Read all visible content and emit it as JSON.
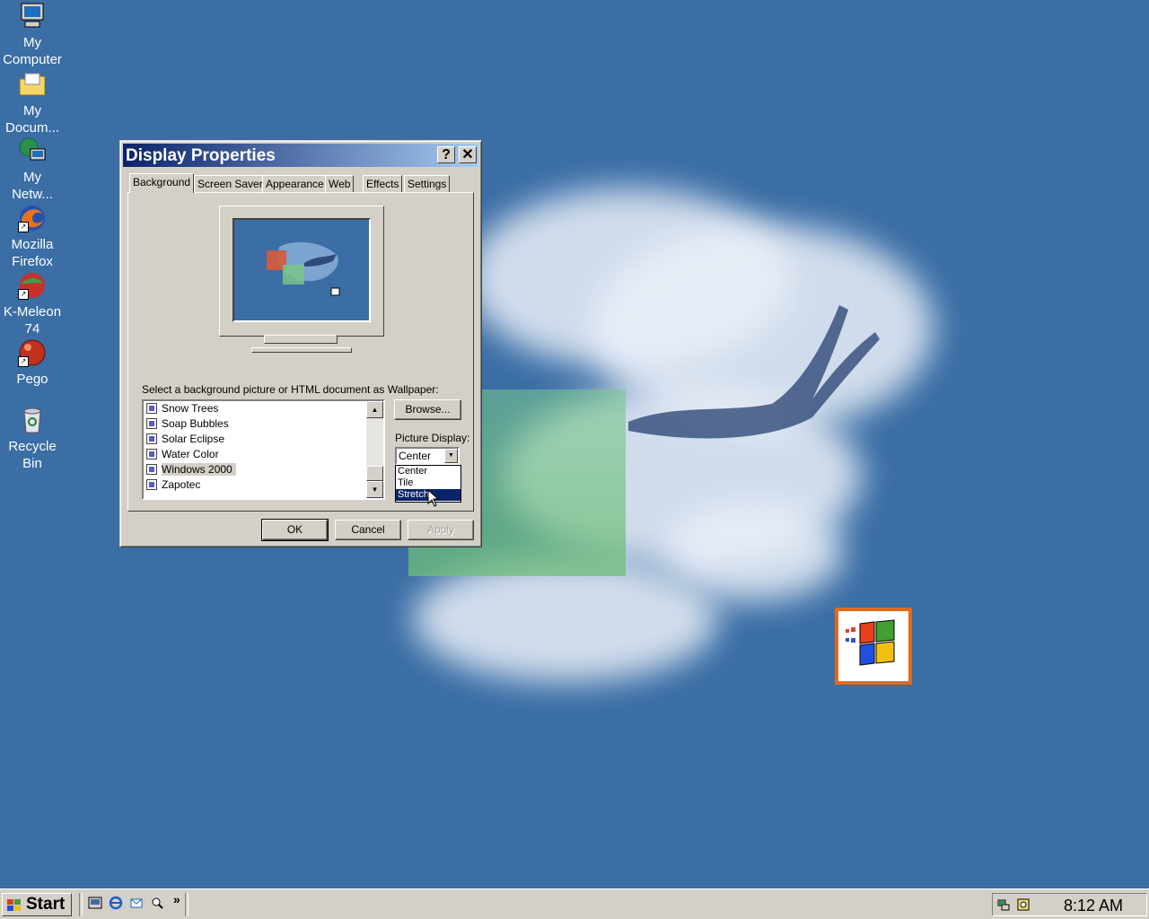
{
  "desktop": {
    "icons": [
      {
        "label_1": "My",
        "label_2": "Computer"
      },
      {
        "label_1": "My",
        "label_2": "Docum..."
      },
      {
        "label_1": "My",
        "label_2": "Netw..."
      },
      {
        "label_1": "Mozilla",
        "label_2": "Firefox"
      },
      {
        "label_1": "K-Meleon",
        "label_2": "74"
      },
      {
        "label_1": "Pego",
        "label_2": ""
      },
      {
        "label_1": "Recycle",
        "label_2": "Bin"
      }
    ]
  },
  "dialog": {
    "title": "Display Properties",
    "help_btn": "?",
    "close_btn": "✕",
    "tabs": [
      "Background",
      "Screen Saver",
      "Appearance",
      "Web",
      "Effects",
      "Settings"
    ],
    "active_tab": "Background",
    "wallpaper_prompt": "Select a background picture or HTML document as Wallpaper:",
    "wallpapers": [
      "Snow Trees",
      "Soap Bubbles",
      "Solar Eclipse",
      "Water Color",
      "Windows 2000",
      "Zapotec"
    ],
    "selected_wallpaper": "Windows 2000",
    "browse_label": "Browse...",
    "picture_display_label": "Picture Display:",
    "picture_display_value": "Center",
    "picture_display_options": [
      "Center",
      "Tile",
      "Stretch"
    ],
    "highlighted_option": "Stretch",
    "ok_label": "OK",
    "cancel_label": "Cancel",
    "apply_label": "Apply"
  },
  "taskbar": {
    "start_label": "Start",
    "quick_launch_more": "»",
    "clock": "8:12 AM"
  },
  "colors": {
    "desktop": "#3a6ea5",
    "title_active": "#0a246a",
    "face": "#d4d0c8"
  }
}
